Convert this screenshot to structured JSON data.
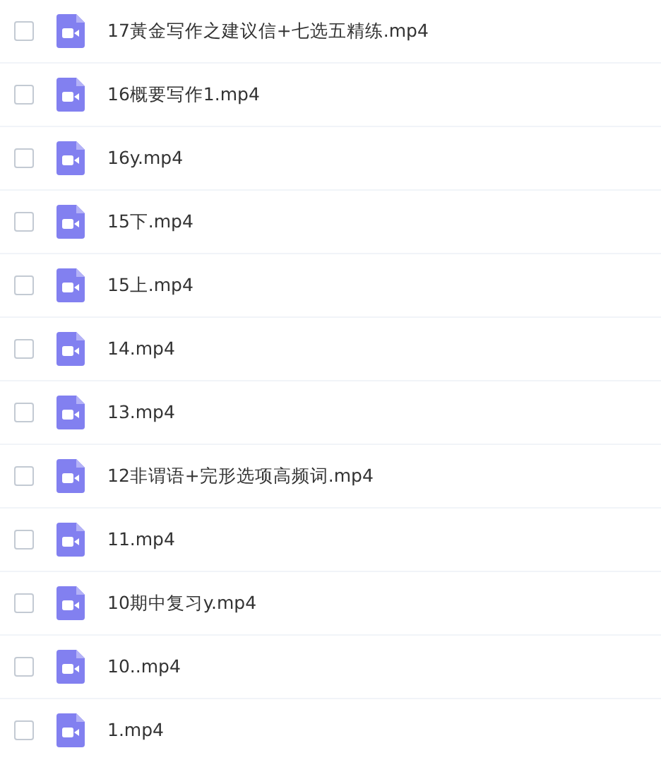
{
  "files": [
    {
      "name": "17黃金写作之建议信+七选五精练.mp4",
      "checked": false
    },
    {
      "name": "16概要写作1.mp4",
      "checked": false
    },
    {
      "name": "16y.mp4",
      "checked": false
    },
    {
      "name": "15下.mp4",
      "checked": false
    },
    {
      "name": "15上.mp4",
      "checked": false
    },
    {
      "name": "14.mp4",
      "checked": false
    },
    {
      "name": "13.mp4",
      "checked": false
    },
    {
      "name": "12非谓语+完形选项高频词.mp4",
      "checked": false
    },
    {
      "name": "11.mp4",
      "checked": false
    },
    {
      "name": "10期中复习y.mp4",
      "checked": false
    },
    {
      "name": "10..mp4",
      "checked": false
    },
    {
      "name": "1.mp4",
      "checked": false
    }
  ]
}
